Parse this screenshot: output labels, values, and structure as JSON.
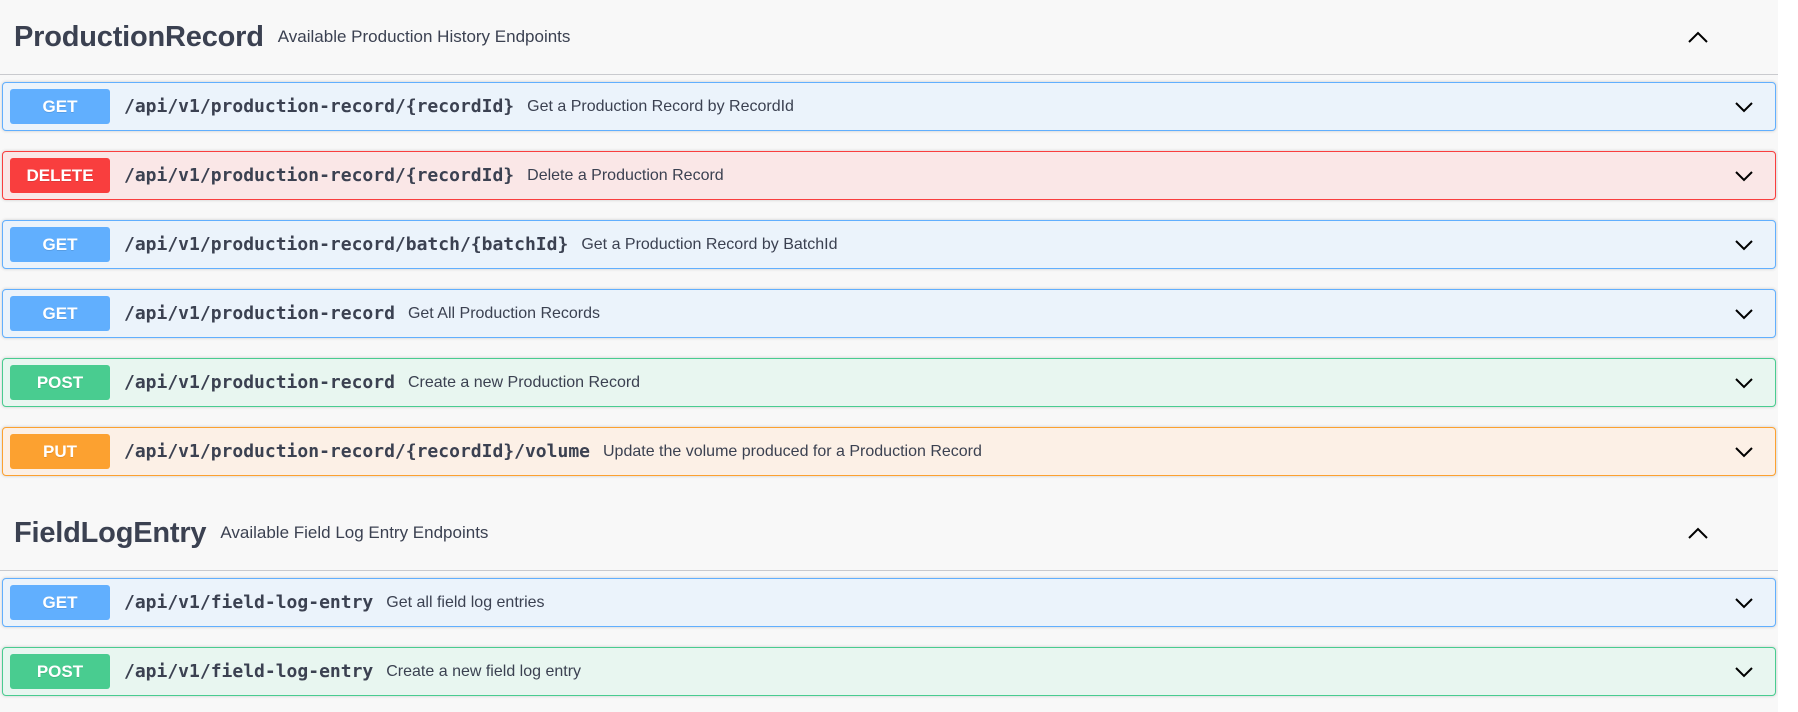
{
  "sections": [
    {
      "title": "ProductionRecord",
      "description": "Available Production History Endpoints",
      "toggle_icon": "chevron-up-icon",
      "operations": [
        {
          "method": "GET",
          "path": "/api/v1/production-record/{recordId}",
          "summary": "Get a Production Record by RecordId"
        },
        {
          "method": "DELETE",
          "path": "/api/v1/production-record/{recordId}",
          "summary": "Delete a Production Record"
        },
        {
          "method": "GET",
          "path": "/api/v1/production-record/batch/{batchId}",
          "summary": "Get a Production Record by BatchId"
        },
        {
          "method": "GET",
          "path": "/api/v1/production-record",
          "summary": "Get All Production Records"
        },
        {
          "method": "POST",
          "path": "/api/v1/production-record",
          "summary": "Create a new Production Record"
        },
        {
          "method": "PUT",
          "path": "/api/v1/production-record/{recordId}/volume",
          "summary": "Update the volume produced for a Production Record"
        }
      ]
    },
    {
      "title": "FieldLogEntry",
      "description": "Available Field Log Entry Endpoints",
      "toggle_icon": "chevron-up-icon",
      "operations": [
        {
          "method": "GET",
          "path": "/api/v1/field-log-entry",
          "summary": "Get all field log entries"
        },
        {
          "method": "POST",
          "path": "/api/v1/field-log-entry",
          "summary": "Create a new field log entry"
        }
      ]
    }
  ],
  "colors": {
    "get": "#61affe",
    "delete": "#f93e3e",
    "post": "#49cc90",
    "put": "#fca130",
    "text": "#3b4151"
  }
}
